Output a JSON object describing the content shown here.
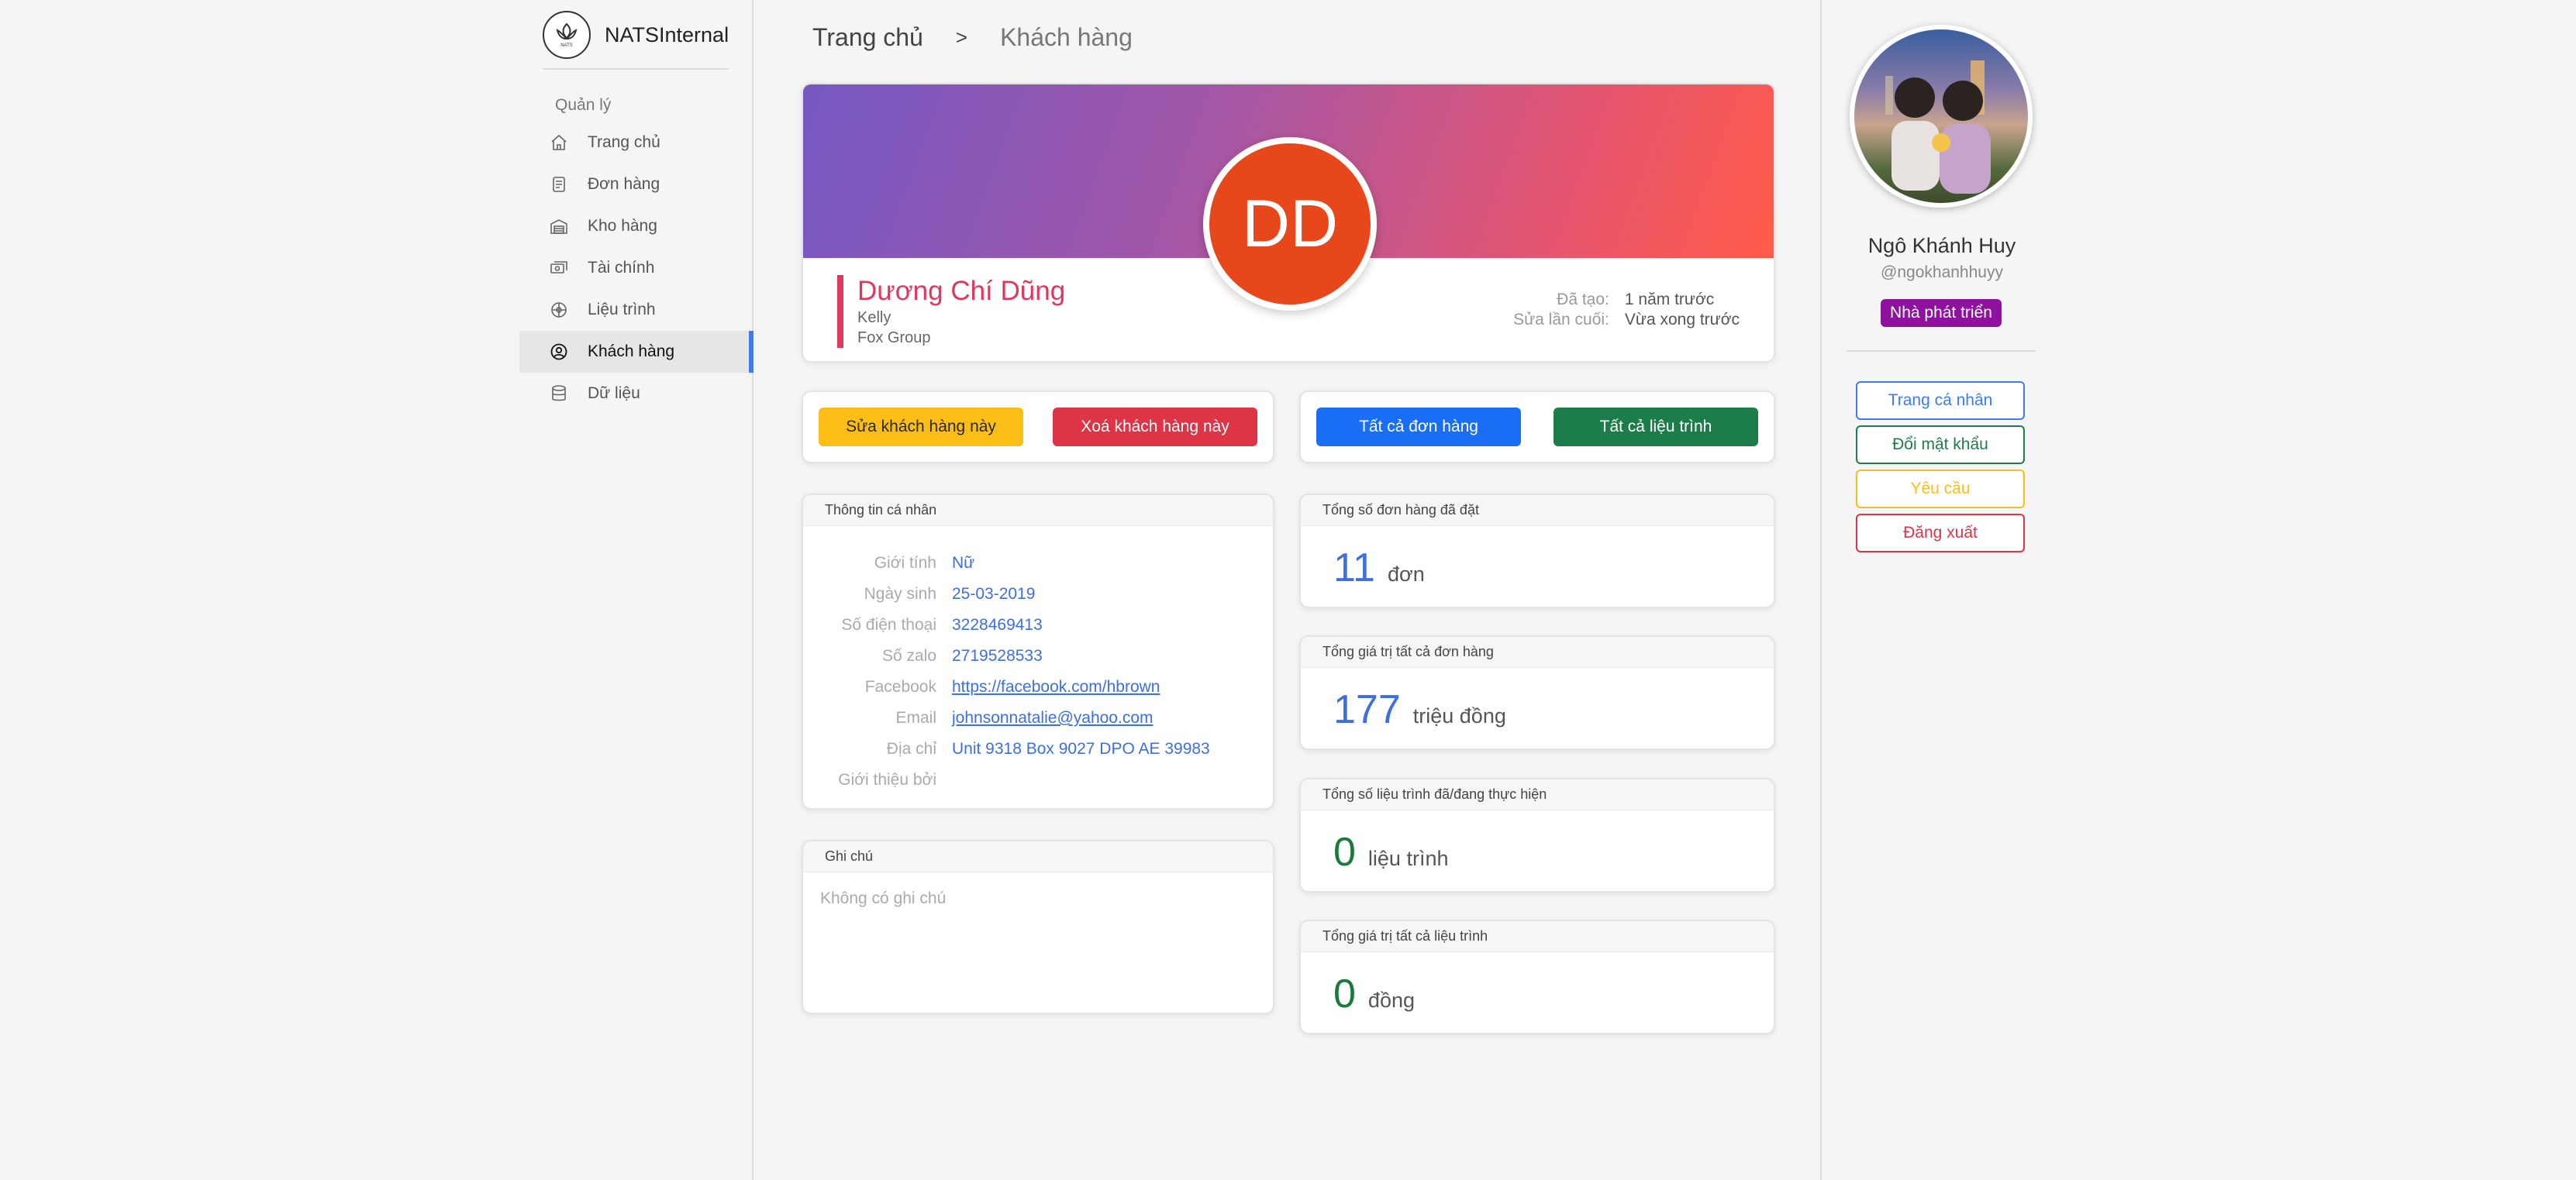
{
  "sidebar": {
    "brand": "NATSInternal",
    "section_title": "Quản lý",
    "items": [
      {
        "label": "Trang chủ",
        "icon": "home-icon"
      },
      {
        "label": "Đơn hàng",
        "icon": "order-icon"
      },
      {
        "label": "Kho hàng",
        "icon": "warehouse-icon"
      },
      {
        "label": "Tài chính",
        "icon": "finance-icon"
      },
      {
        "label": "Liệu trình",
        "icon": "treatment-icon"
      },
      {
        "label": "Khách hàng",
        "icon": "customer-icon",
        "active": true
      },
      {
        "label": "Dữ liệu",
        "icon": "database-icon"
      }
    ]
  },
  "breadcrumb": {
    "home": "Trang chủ",
    "separator": ">",
    "current": "Khách hàng"
  },
  "customer": {
    "initials": "DD",
    "name": "Dương Chí Dũng",
    "nickname": "Kelly",
    "company": "Fox Group",
    "created_label": "Đã tạo:",
    "created_value": "1 năm trước",
    "updated_label": "Sửa lần cuối:",
    "updated_value": "Vừa xong trước"
  },
  "actions": {
    "edit": "Sửa khách hàng này",
    "delete": "Xoá khách hàng này",
    "all_orders": "Tất cả đơn hàng",
    "all_treatments": "Tất cả liệu trình"
  },
  "personal_info": {
    "title": "Thông tin cá nhân",
    "rows": [
      {
        "label": "Giới tính",
        "value": "Nữ"
      },
      {
        "label": "Ngày sinh",
        "value": "25-03-2019"
      },
      {
        "label": "Số điện thoại",
        "value": "3228469413"
      },
      {
        "label": "Số zalo",
        "value": "2719528533"
      },
      {
        "label": "Facebook",
        "value": "https://facebook.com/hbrown"
      },
      {
        "label": "Email",
        "value": "johnsonnatalie@yahoo.com"
      },
      {
        "label": "Địa chỉ",
        "value": "Unit 9318 Box 9027 DPO AE 39983"
      },
      {
        "label": "Giới thiệu bởi",
        "value": ""
      }
    ]
  },
  "note": {
    "title": "Ghi chú",
    "body": "Không có ghi chú"
  },
  "stats": [
    {
      "title": "Tổng số đơn hàng đã đặt",
      "value": "11",
      "unit": "đơn",
      "color": "#3d6fe0"
    },
    {
      "title": "Tổng giá trị tất cả đơn hàng",
      "value": "177",
      "unit": "triệu đồng",
      "color": "#3d6fe0"
    },
    {
      "title": "Tổng số liệu trình đã/đang thực hiện",
      "value": "0",
      "unit": "liệu trình",
      "color": "#1a7a3c"
    },
    {
      "title": "Tổng giá trị tất cả liệu trình",
      "value": "0",
      "unit": "đồng",
      "color": "#1a7a3c"
    }
  ],
  "user": {
    "name": "Ngô Khánh Huy",
    "handle": "@ngokhanhhuyy",
    "role": "Nhà phát triển",
    "buttons": {
      "profile": "Trang cá nhân",
      "change_password": "Đổi mật khẩu",
      "requests": "Yêu cầu",
      "logout": "Đăng xuất"
    }
  },
  "colors": {
    "accent": "#3d7bf0",
    "name_accent": "#e0385c",
    "avatar_bg": "#e8471b",
    "role_badge": "#8e129d"
  }
}
